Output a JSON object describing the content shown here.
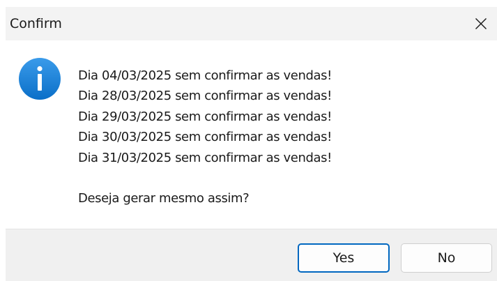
{
  "window": {
    "title": "Confirm",
    "close_icon": "close-icon"
  },
  "message": {
    "icon": "info-icon",
    "lines": [
      "Dia 04/03/2025 sem confirmar as vendas!",
      "Dia 28/03/2025 sem confirmar as vendas!",
      "Dia 29/03/2025 sem confirmar as vendas!",
      "Dia 30/03/2025 sem confirmar as vendas!",
      "Dia 31/03/2025 sem confirmar as vendas!"
    ],
    "question": "Deseja gerar mesmo assim?"
  },
  "buttons": {
    "yes_label": "Yes",
    "no_label": "No"
  },
  "colors": {
    "accent": "#0067c0",
    "info_icon": "#1a7fd4",
    "titlebar_bg": "#f3f3f3",
    "footer_bg": "#f0f0f0"
  }
}
